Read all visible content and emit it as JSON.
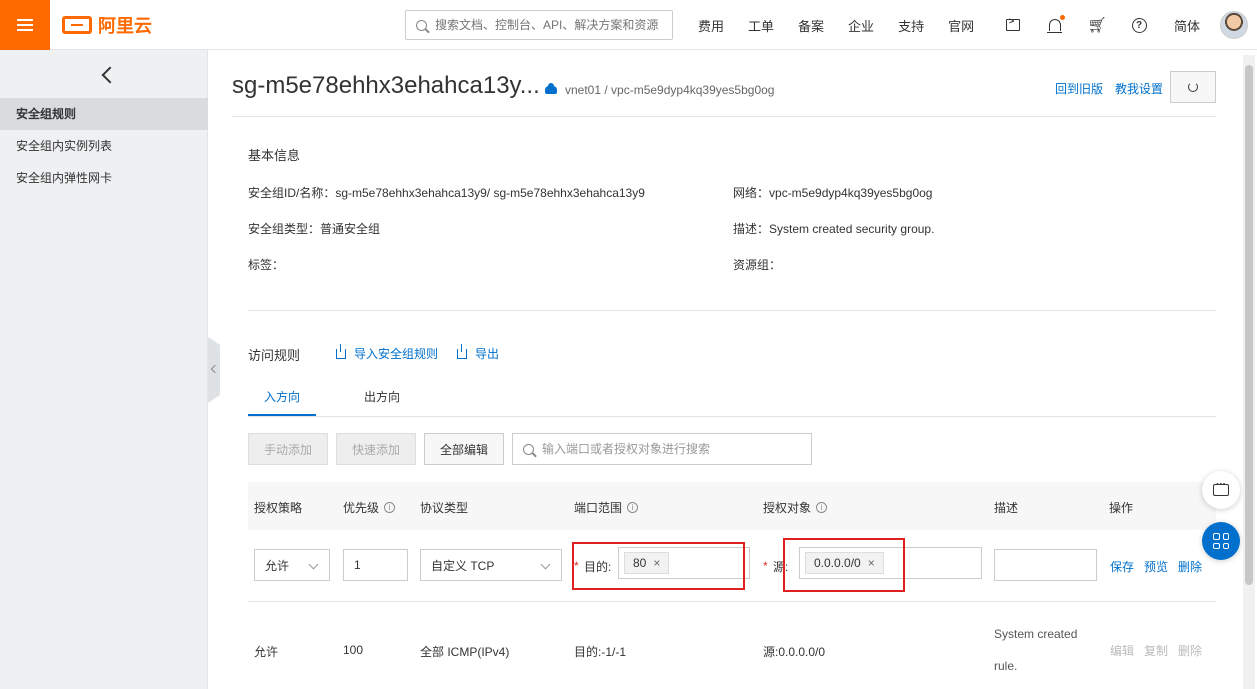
{
  "topbar": {
    "search_placeholder": "搜索文档、控制台、API、解决方案和资源",
    "nav": [
      "费用",
      "工单",
      "备案",
      "企业",
      "支持",
      "官网"
    ],
    "lang": "简体",
    "logo_text": "阿里云",
    "brand_color": "#ff6a00"
  },
  "sidebar": {
    "items": [
      {
        "label": "安全组规则",
        "active": true
      },
      {
        "label": "安全组内实例列表",
        "active": false
      },
      {
        "label": "安全组内弹性网卡",
        "active": false
      }
    ]
  },
  "header": {
    "title": "sg-m5e78ehhx3ehahca13y...",
    "subtitle": "vnet01 / vpc-m5e9dyp4kq39yes5bg0og",
    "back_old": "回到旧版",
    "teach": "教我设置"
  },
  "basic": {
    "title": "基本信息",
    "id_label": "安全组ID/名称：",
    "id_value": "sg-m5e78ehhx3ehahca13y9/ sg-m5e78ehhx3ehahca13y9",
    "type_label": "安全组类型：",
    "type_value": "普通安全组",
    "tag_label": "标签：",
    "network_label": "网络：",
    "network_value": "vpc-m5e9dyp4kq39yes5bg0og",
    "desc_label": "描述：",
    "desc_value": "System created security group.",
    "rg_label": "资源组："
  },
  "rules": {
    "title": "访问规则",
    "import": "导入安全组规则",
    "export": "导出",
    "tabs": [
      "入方向",
      "出方向"
    ],
    "btn_manual": "手动添加",
    "btn_quick": "快速添加",
    "btn_edit_all": "全部编辑",
    "search_placeholder": "输入端口或者授权对象进行搜索",
    "columns": [
      "授权策略",
      "优先级",
      "协议类型",
      "端口范围",
      "授权对象",
      "描述",
      "操作"
    ],
    "edit_row": {
      "policy": "允许",
      "priority": "1",
      "protocol": "自定义 TCP",
      "dest_label": "目的:",
      "dest_tag": "80",
      "src_label": "源:",
      "src_tag": "0.0.0.0/0",
      "actions": [
        "保存",
        "预览",
        "删除"
      ]
    },
    "row": {
      "policy": "允许",
      "priority": "100",
      "protocol": "全部 ICMP(IPv4)",
      "port": "目的:-1/-1",
      "source": "源:0.0.0.0/0",
      "desc_line1": "System created",
      "desc_line2": "rule.",
      "actions": [
        "编辑",
        "复制",
        "删除"
      ]
    }
  }
}
